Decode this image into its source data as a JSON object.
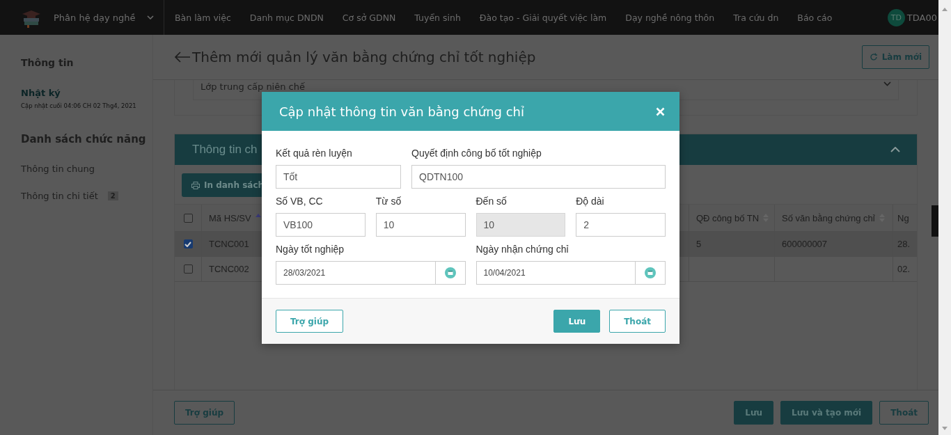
{
  "topbar": {
    "module": "Phân hệ dạy nghề",
    "menu": [
      "Bàn làm việc",
      "Danh mục DNDN",
      "Cơ sở GDNN",
      "Tuyển sinh",
      "Đào tạo - Giải quyết việc làm",
      "Dạy nghề nông thôn",
      "Tra cứu dn",
      "Báo cáo"
    ],
    "user": {
      "initials": "TD",
      "name": "TDA00"
    }
  },
  "sidebar": {
    "info_title": "Thông tin",
    "log_link": "Nhật ký",
    "log_updated": "Cập nhật cuối 04:06 CH 02 Thg4, 2021",
    "functions_title": "Danh sách chức năng",
    "items": [
      {
        "label": "Thông tin chung"
      },
      {
        "label": "Thông tin chi tiết",
        "badge": "2"
      }
    ]
  },
  "page": {
    "title": "Thêm mới quản lý văn bằng chứng chỉ tốt nghiệp",
    "refresh_button": "Làm mới",
    "class_select": "Lớp trung cấp niên chế",
    "section_title": "Thông tin ch",
    "print_button": "In danh sách",
    "table": {
      "select_all_checked": false,
      "columns": [
        {
          "label": "Mã HS/SV",
          "sorted": true
        },
        {
          "label": "QĐ công bố TN",
          "sorted": false
        },
        {
          "label": "Số văn bằng chứng chỉ",
          "sorted": false
        },
        {
          "label": "Ng"
        }
      ],
      "rows": [
        {
          "checked": true,
          "cells": [
            "TCNC001",
            "5",
            "600000007",
            "28."
          ]
        },
        {
          "checked": false,
          "cells": [
            "TCNC002",
            null,
            null,
            "02."
          ]
        }
      ]
    },
    "footer": {
      "help_button": "Trợ giúp",
      "buttons": [
        {
          "label": "Lưu",
          "kind": "primary"
        },
        {
          "label": "Lưu và tạo mới",
          "kind": "primary"
        },
        {
          "label": "Thoát",
          "kind": "outline"
        }
      ]
    }
  },
  "modal": {
    "title": "Cập nhật thông tin văn bằng chứng chỉ",
    "rows": [
      {
        "fields": [
          {
            "label": "Kết quả rèn luyện",
            "value": "Tốt",
            "kind": "text",
            "disabled": false
          },
          {
            "label": "Quyết định công bố tốt nghiệp",
            "value": "QDTN100",
            "kind": "text",
            "disabled": false
          }
        ]
      },
      {
        "fields": [
          {
            "label": "Số VB, CC",
            "value": "VB100",
            "kind": "text",
            "disabled": false
          },
          {
            "label": "Từ số",
            "value": "10",
            "kind": "text",
            "disabled": false
          },
          {
            "label": "Đến số",
            "value": "10",
            "kind": "text",
            "disabled": true
          },
          {
            "label": "Độ dài",
            "value": "2",
            "kind": "text",
            "disabled": false
          }
        ]
      },
      {
        "fields": [
          {
            "label": "Ngày tốt nghiệp",
            "value": "28/03/2021",
            "kind": "date"
          },
          {
            "label": "Ngày nhận chứng chỉ",
            "value": "10/04/2021",
            "kind": "date"
          }
        ]
      }
    ],
    "help_button": "Trợ giúp",
    "buttons": [
      {
        "label": "Lưu",
        "kind": "primary"
      },
      {
        "label": "Thoát",
        "kind": "outline"
      }
    ]
  }
}
